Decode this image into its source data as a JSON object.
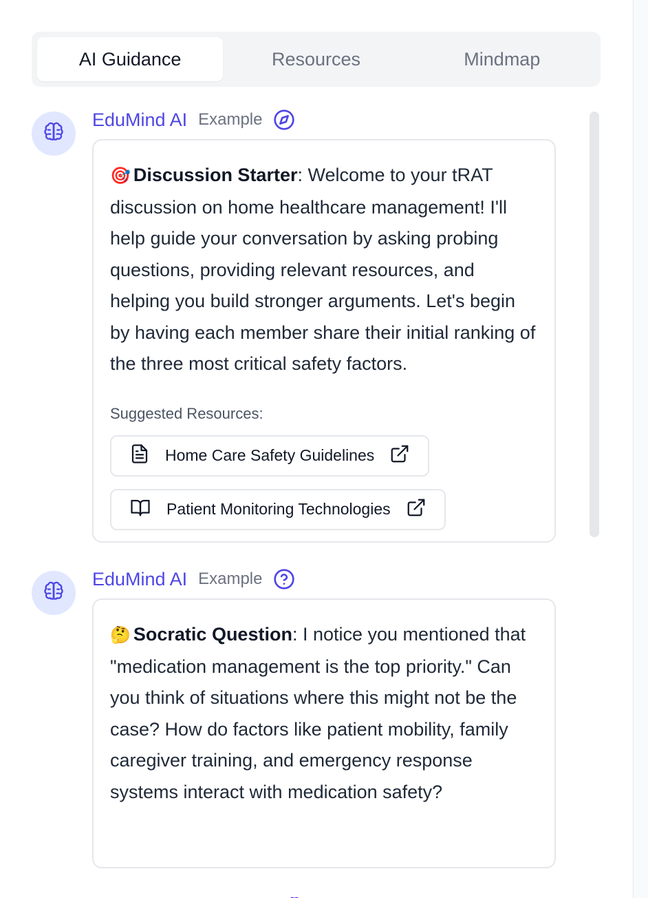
{
  "tabs": [
    {
      "label": "AI Guidance",
      "active": true
    },
    {
      "label": "Resources",
      "active": false
    },
    {
      "label": "Mindmap",
      "active": false
    }
  ],
  "messages": [
    {
      "author": "EduMind AI",
      "tag": "Example",
      "tag_icon": "compass-icon",
      "emoji": "🎯",
      "title": "Discussion Starter",
      "body": ": Welcome to your tRAT discussion on home healthcare management! I'll help guide your conversation by asking probing questions, providing relevant resources, and helping you build stronger arguments. Let's begin by having each member share their initial ranking of the three most critical safety factors.",
      "suggested_title": "Suggested Resources:",
      "resources": [
        {
          "label": "Home Care Safety Guidelines",
          "icon": "document-icon"
        },
        {
          "label": "Patient Monitoring Technologies",
          "icon": "book-icon"
        }
      ]
    },
    {
      "author": "EduMind AI",
      "tag": "Example",
      "tag_icon": "question-circle-icon",
      "emoji": "🤔",
      "title": "Socratic Question",
      "body": ": I notice you mentioned that \"medication management is the top priority.\" Can you think of situations where this might not be the case? How do factors like patient mobility, family caregiver training, and emergency response systems interact with medication safety?"
    }
  ],
  "colors": {
    "accent": "#4f46e5",
    "avatar_bg": "#e0e7ff",
    "border": "#e5e7eb",
    "tab_bg": "#f3f4f6"
  }
}
